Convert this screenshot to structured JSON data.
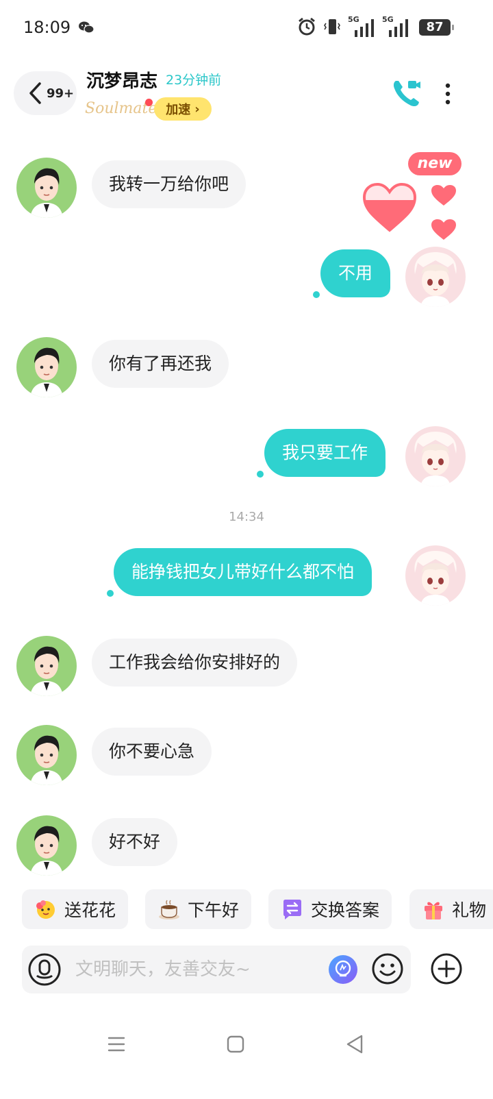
{
  "status_bar": {
    "time": "18:09",
    "battery": "87",
    "network_label_1": "5G",
    "network_label_2": "5G",
    "icons": [
      "wechat-icon",
      "alarm-icon",
      "vibrate-icon",
      "signal-icon",
      "battery-icon"
    ]
  },
  "header": {
    "unread_count": "99+",
    "contact_name": "沉梦昂志",
    "last_seen": "23分钟前",
    "brand_logo": "Soulmate",
    "speed_badge": "加速",
    "speed_arrow": "›",
    "icons": [
      "back-chevron-icon",
      "video-call-icon",
      "more-vertical-icon"
    ]
  },
  "chat": {
    "new_badge": "new",
    "timestamp": "14:34",
    "messages": [
      {
        "direction": "in",
        "text": "我转一万给你吧"
      },
      {
        "direction": "out",
        "text": "不用"
      },
      {
        "direction": "in",
        "text": "你有了再还我"
      },
      {
        "direction": "out",
        "text": "我只要工作"
      },
      {
        "direction": "out",
        "text": "能挣钱把女儿带好什么都不怕"
      },
      {
        "direction": "in",
        "text": "工作我会给你安排好的"
      },
      {
        "direction": "in",
        "text": "你不要心急"
      },
      {
        "direction": "in",
        "text": "好不好"
      }
    ]
  },
  "quick_replies": [
    {
      "label": "送花花",
      "icon": "flower-emoji-icon"
    },
    {
      "label": "下午好",
      "icon": "coffee-icon"
    },
    {
      "label": "交换答案",
      "icon": "exchange-icon"
    },
    {
      "label": "礼物",
      "icon": "gift-icon"
    }
  ],
  "input": {
    "placeholder": "文明聊天，友善交友~",
    "icons": [
      "voice-icon",
      "ai-icon",
      "emoji-icon",
      "plus-icon"
    ]
  },
  "nav": {
    "icons": [
      "nav-menu-icon",
      "nav-home-icon",
      "nav-back-icon"
    ]
  },
  "colors": {
    "accent": "#2fd2cf",
    "incoming_bubble": "#f4f4f5",
    "badge": "#ffe46e",
    "new_badge": "#ff6b78",
    "heart": "#ff6b78"
  }
}
